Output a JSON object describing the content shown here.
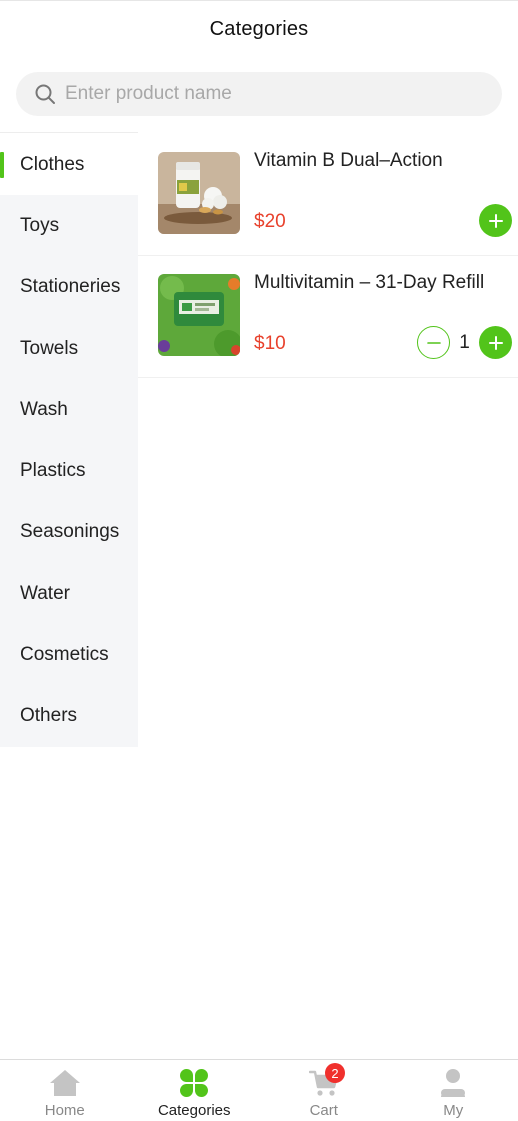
{
  "header": {
    "title": "Categories"
  },
  "search": {
    "placeholder": "Enter product name",
    "value": ""
  },
  "sidebar": {
    "active_index": 0,
    "items": [
      {
        "label": "Clothes"
      },
      {
        "label": "Toys"
      },
      {
        "label": "Stationeries"
      },
      {
        "label": "Towels"
      },
      {
        "label": "Wash"
      },
      {
        "label": "Plastics"
      },
      {
        "label": "Seasonings"
      },
      {
        "label": "Water"
      },
      {
        "label": "Cosmetics"
      },
      {
        "label": "Others"
      }
    ]
  },
  "products": [
    {
      "name": "Vitamin B Dual–Action",
      "price": "$20",
      "quantity": 0
    },
    {
      "name": "Multivitamin – 31-Day Refill",
      "price": "$10",
      "quantity": 1
    }
  ],
  "tabbar": {
    "active_index": 1,
    "items": [
      {
        "label": "Home",
        "icon": "home-icon"
      },
      {
        "label": "Categories",
        "icon": "clover-icon"
      },
      {
        "label": "Cart",
        "icon": "cart-icon",
        "badge": "2"
      },
      {
        "label": "My",
        "icon": "user-icon"
      }
    ]
  },
  "colors": {
    "accent": "#52c41a",
    "price": "#e8412c",
    "badge": "#f0302d",
    "sidebar_bg": "#f5f6f8"
  }
}
